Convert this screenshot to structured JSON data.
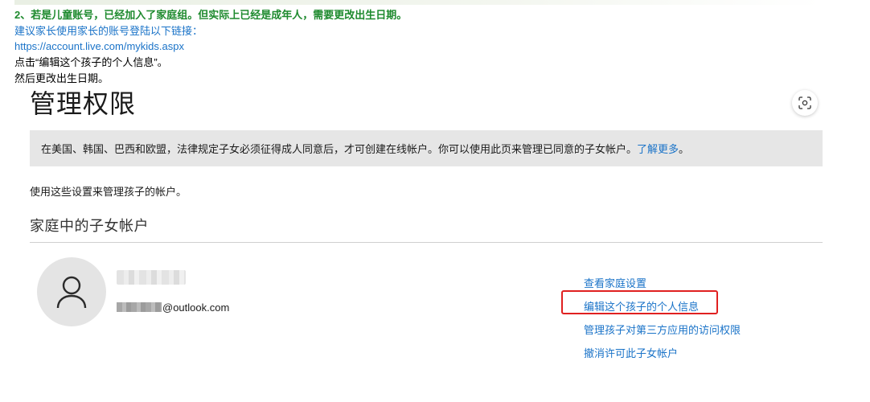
{
  "notes": {
    "heading": "2、若是儿童账号，已经加入了家庭组。但实际上已经是成年人，需要更改出生日期。",
    "tip": "建议家长使用家长的账号登陆以下链接：",
    "url": "https://account.live.com/mykids.aspx",
    "click_instruction": "点击“编辑这个孩子的个人信息”。",
    "then_instruction": "然后更改出生日期。"
  },
  "page": {
    "title": "管理权限",
    "focus_icon": "focus-scan-icon"
  },
  "notice": {
    "text": "在美国、韩国、巴西和欧盟，法律规定子女必须征得成人同意后，才可创建在线帐户。你可以使用此页来管理已同意的子女帐户。",
    "link": "了解更多",
    "end": "。"
  },
  "manage_text": "使用这些设置来管理孩子的帐户。",
  "section": {
    "title": "家庭中的子女帐户"
  },
  "child": {
    "avatar_icon": "person-icon",
    "email_suffix": "@outlook.com"
  },
  "actions": {
    "view_family": "查看家庭设置",
    "edit_info": "编辑这个孩子的个人信息",
    "manage_apps": "管理孩子对第三方应用的访问权限",
    "revoke": "撤消许可此子女帐户"
  },
  "colors": {
    "heading_green": "#1e8a2e",
    "link_blue": "#1a73c8",
    "highlight_red": "#e02020",
    "notice_bg": "#e6e6e6"
  }
}
